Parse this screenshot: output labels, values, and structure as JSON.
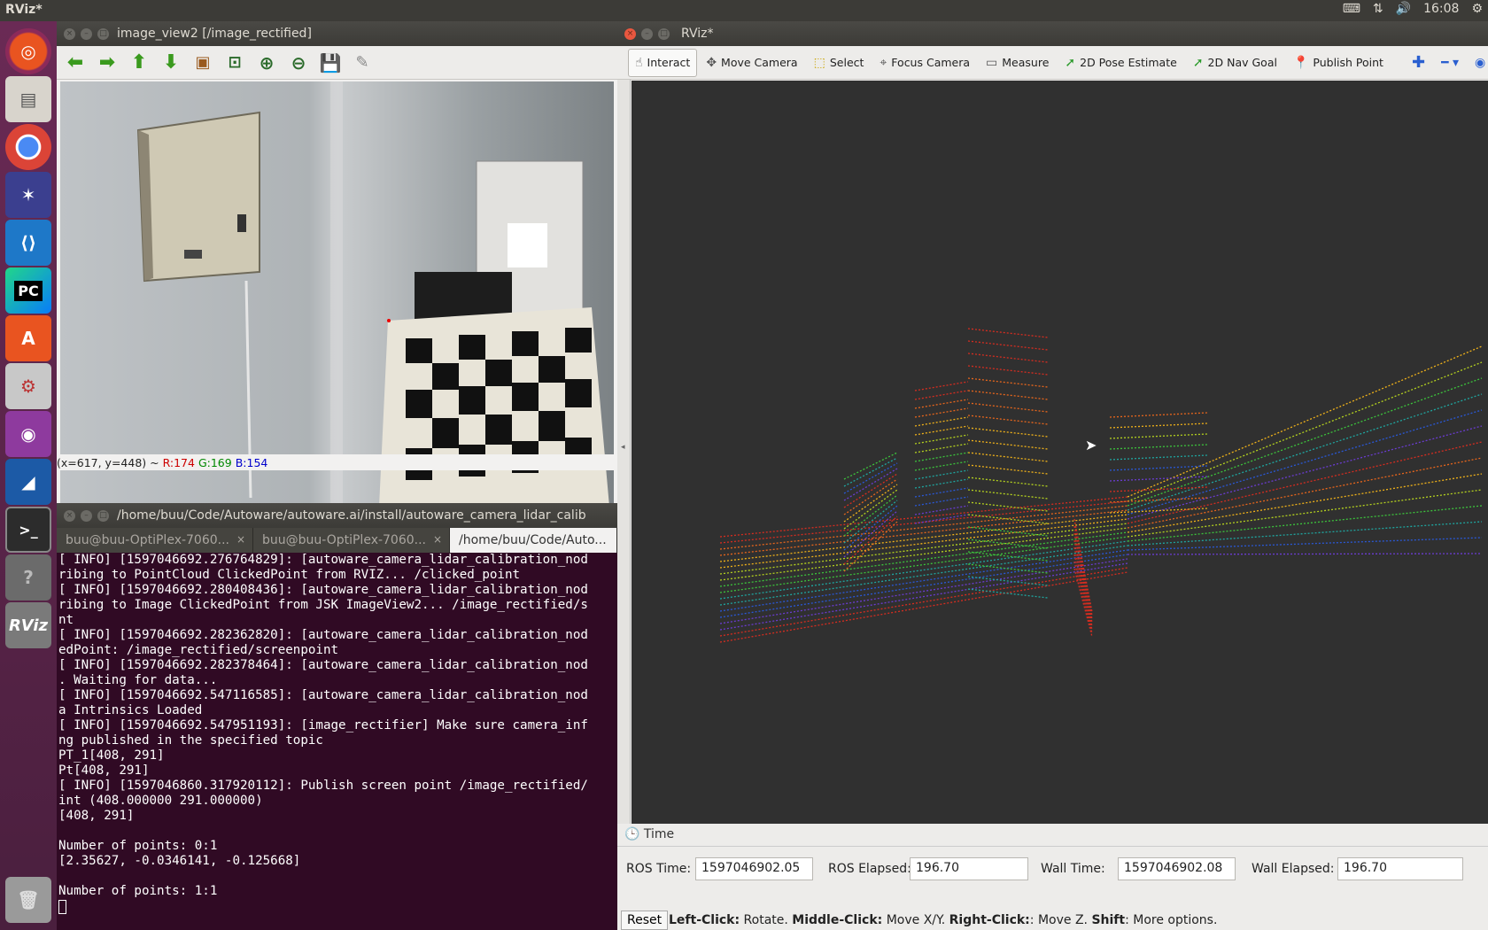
{
  "topbar": {
    "title": "RViz*",
    "clock": "16:08"
  },
  "launcher": {
    "items": [
      "ubuntu-icon",
      "files-icon",
      "chrome-icon",
      "app-icon",
      "vscode-icon",
      "pycharm-icon",
      "software-center-icon",
      "settings-icon",
      "webcam-icon",
      "wireshark-icon",
      "terminal-icon",
      "help-icon",
      "rviz-icon",
      "trash-icon"
    ],
    "pycharm_label": "PC",
    "rviz_label": "RViz"
  },
  "image_view": {
    "title": "image_view2 [/image_rectified]",
    "status_pos": "(x=617, y=448) ~ ",
    "status_r": "R:174",
    "status_g": "G:169",
    "status_b": "B:154"
  },
  "terminal": {
    "title": "/home/buu/Code/Autoware/autoware.ai/install/autoware_camera_lidar_calib",
    "tabs": [
      "buu@buu-OptiPlex-7060...",
      "buu@buu-OptiPlex-7060...",
      "/home/buu/Code/Auto..."
    ],
    "lines": [
      "[ INFO] [1597046692.276764829]: [autoware_camera_lidar_calibration_nod",
      "ribing to PointCloud ClickedPoint from RVIZ... /clicked_point",
      "[ INFO] [1597046692.280408436]: [autoware_camera_lidar_calibration_nod",
      "ribing to Image ClickedPoint from JSK ImageView2... /image_rectified/s",
      "nt",
      "[ INFO] [1597046692.282362820]: [autoware_camera_lidar_calibration_nod",
      "edPoint: /image_rectified/screenpoint",
      "[ INFO] [1597046692.282378464]: [autoware_camera_lidar_calibration_nod",
      ". Waiting for data...",
      "[ INFO] [1597046692.547116585]: [autoware_camera_lidar_calibration_nod",
      "a Intrinsics Loaded",
      "[ INFO] [1597046692.547951193]: [image_rectifier] Make sure camera_inf",
      "ng published in the specified topic",
      "PT_1[408, 291]",
      "Pt[408, 291]",
      "[ INFO] [1597046860.317920112]: Publish screen point /image_rectified/",
      "int (408.000000 291.000000)",
      "[408, 291]",
      "",
      "Number of points: 0:1",
      "[2.35627, -0.0346141, -0.125668]",
      "",
      "Number of points: 1:1"
    ]
  },
  "rviz": {
    "title": "RViz*",
    "tools": [
      {
        "label": "Interact",
        "icon": "hand-icon"
      },
      {
        "label": "Move Camera",
        "icon": "move-icon"
      },
      {
        "label": "Select",
        "icon": "select-icon"
      },
      {
        "label": "Focus Camera",
        "icon": "focus-icon"
      },
      {
        "label": "Measure",
        "icon": "ruler-icon"
      },
      {
        "label": "2D Pose Estimate",
        "icon": "pose-arrow-icon"
      },
      {
        "label": "2D Nav Goal",
        "icon": "nav-arrow-icon"
      },
      {
        "label": "Publish Point",
        "icon": "pin-icon"
      }
    ],
    "time_panel": {
      "header": "Time",
      "ros_time_label": "ROS Time:",
      "ros_time": "1597046902.05",
      "ros_elapsed_label": "ROS Elapsed:",
      "ros_elapsed": "196.70",
      "wall_time_label": "Wall Time:",
      "wall_time": "1597046902.08",
      "wall_elapsed_label": "Wall Elapsed:",
      "wall_elapsed": "196.70"
    },
    "reset_label": "Reset",
    "hint": [
      {
        "b": "Left-Click:",
        "t": " Rotate. "
      },
      {
        "b": "Middle-Click:",
        "t": " Move X/Y. "
      },
      {
        "b": "Right-Click:",
        "t": ": Move Z. "
      },
      {
        "b": "Shift",
        "t": ": More options."
      }
    ]
  }
}
